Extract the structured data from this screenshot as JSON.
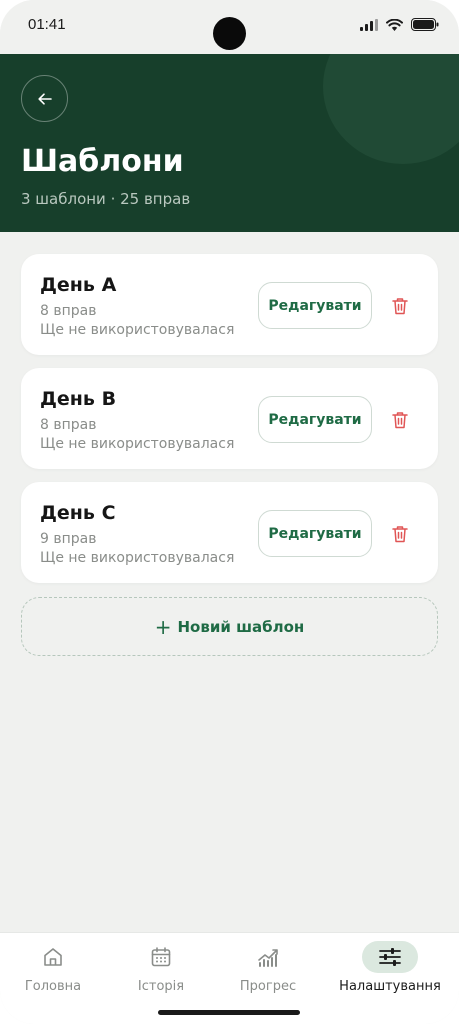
{
  "status_bar": {
    "time": "01:41"
  },
  "header": {
    "title": "Шаблони",
    "subtitle": "3 шаблони · 25 вправ"
  },
  "templates": [
    {
      "name": "День A",
      "count": "8 вправ",
      "usage": "Ще не використовувалася",
      "edit_label": "Редагувати"
    },
    {
      "name": "День B",
      "count": "8 вправ",
      "usage": "Ще не використовувалася",
      "edit_label": "Редагувати"
    },
    {
      "name": "День C",
      "count": "9 вправ",
      "usage": "Ще не використовувалася",
      "edit_label": "Редагувати"
    }
  ],
  "new_template": {
    "plus": "+",
    "label": "Новий шаблон"
  },
  "tabs": [
    {
      "label": "Головна",
      "icon": "home-icon",
      "active": false
    },
    {
      "label": "Історія",
      "icon": "calendar-icon",
      "active": false
    },
    {
      "label": "Прогрес",
      "icon": "chart-icon",
      "active": false
    },
    {
      "label": "Налаштування",
      "icon": "sliders-icon",
      "active": true
    }
  ],
  "colors": {
    "header_bg": "#173f2b",
    "accent": "#1f6b45",
    "danger": "#e05555",
    "background": "#f0f1ef"
  }
}
